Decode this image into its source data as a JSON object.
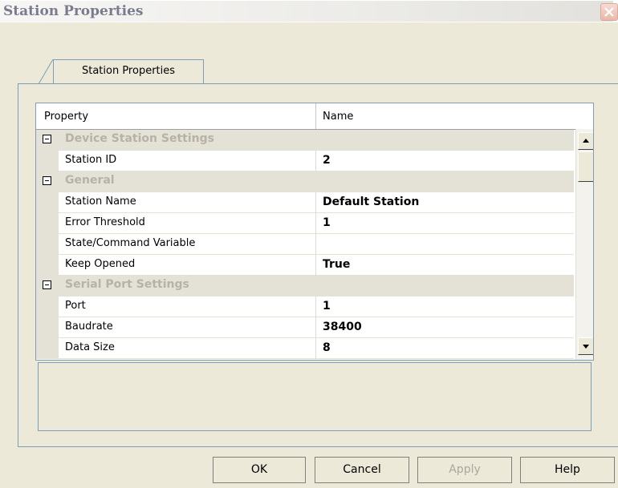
{
  "window": {
    "title": "Station Properties"
  },
  "tabs": [
    {
      "label": "Station Properties"
    }
  ],
  "grid": {
    "columns": [
      "Property",
      "Name"
    ],
    "rows": [
      {
        "type": "category",
        "label": "Device Station Settings"
      },
      {
        "type": "property",
        "name": "Station ID",
        "value": "2"
      },
      {
        "type": "category",
        "label": "General"
      },
      {
        "type": "property",
        "name": "Station Name",
        "value": "Default Station"
      },
      {
        "type": "property",
        "name": "Error Threshold",
        "value": "1"
      },
      {
        "type": "property",
        "name": "State/Command Variable",
        "value": ""
      },
      {
        "type": "property",
        "name": "Keep Opened",
        "value": "True"
      },
      {
        "type": "category",
        "label": "Serial Port Settings"
      },
      {
        "type": "property",
        "name": "Port",
        "value": "1"
      },
      {
        "type": "property",
        "name": "Baudrate",
        "value": "38400"
      },
      {
        "type": "property",
        "name": "Data Size",
        "value": "8"
      }
    ]
  },
  "buttons": {
    "ok": "OK",
    "cancel": "Cancel",
    "apply": "Apply",
    "help": "Help"
  },
  "icons": {
    "close": "close-icon",
    "collapse": "minus-box-icon",
    "scroll_up": "arrow-up-icon",
    "scroll_down": "arrow-down-icon"
  }
}
